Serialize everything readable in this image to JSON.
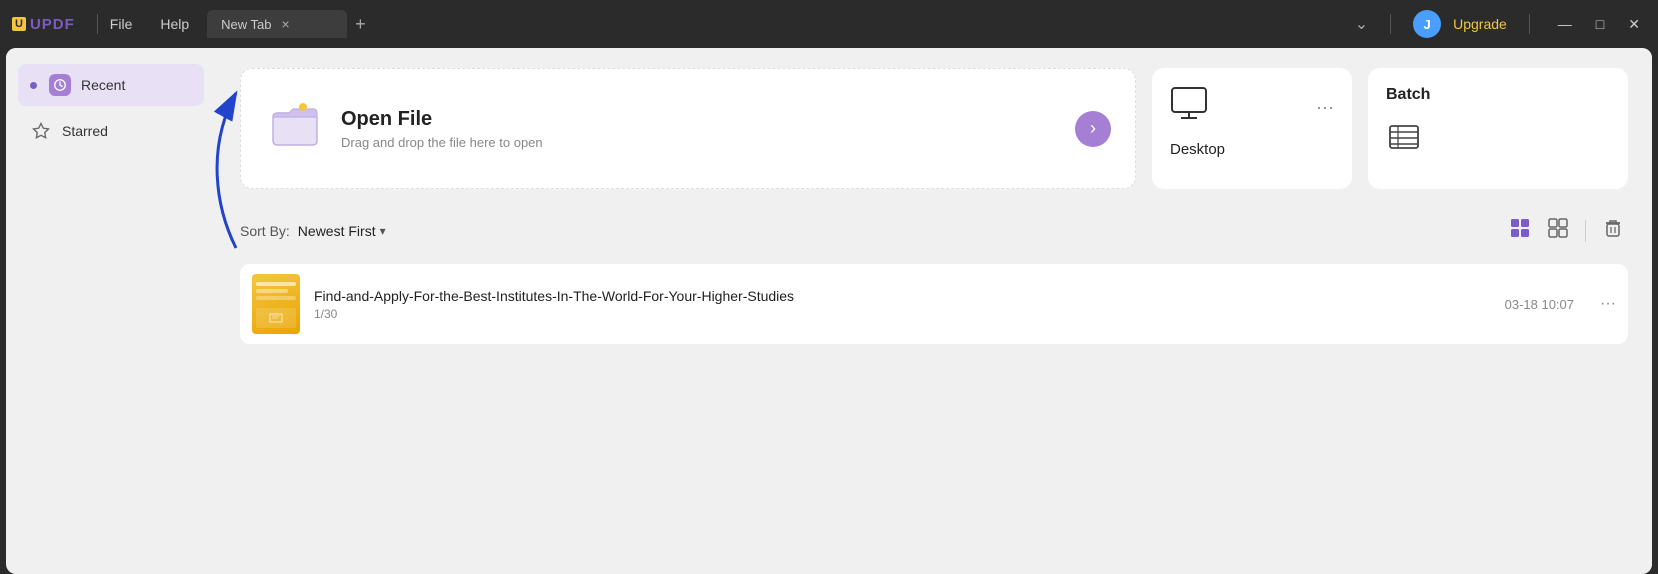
{
  "app": {
    "logo": "UPDF",
    "logo_bg": "U"
  },
  "titlebar": {
    "menu": [
      "File",
      "Help"
    ],
    "tab_label": "New Tab",
    "close_icon": "×",
    "add_icon": "+",
    "dropdown_icon": "⌄",
    "avatar_letter": "J",
    "upgrade_label": "Upgrade",
    "min_icon": "—",
    "max_icon": "□",
    "x_icon": "✕"
  },
  "sidebar": {
    "items": [
      {
        "id": "recent",
        "label": "Recent",
        "active": true
      },
      {
        "id": "starred",
        "label": "Starred",
        "active": false
      }
    ]
  },
  "top_cards": {
    "open_file": {
      "title": "Open File",
      "subtitle": "Drag and drop the file here to open",
      "arrow": "›"
    },
    "desktop": {
      "label": "Desktop",
      "more": "···"
    },
    "batch": {
      "title": "Batch"
    }
  },
  "sort_bar": {
    "label": "Sort By:",
    "selected": "Newest First",
    "arrow": "▾"
  },
  "view_icons": {
    "grid_active": "active",
    "grid_inactive": "inactive"
  },
  "files": [
    {
      "name": "Find-and-Apply-For-the-Best-Institutes-In-The-World-For-Your-Higher-Studies",
      "pages": "1/30",
      "date": "03-18 10:07"
    }
  ]
}
